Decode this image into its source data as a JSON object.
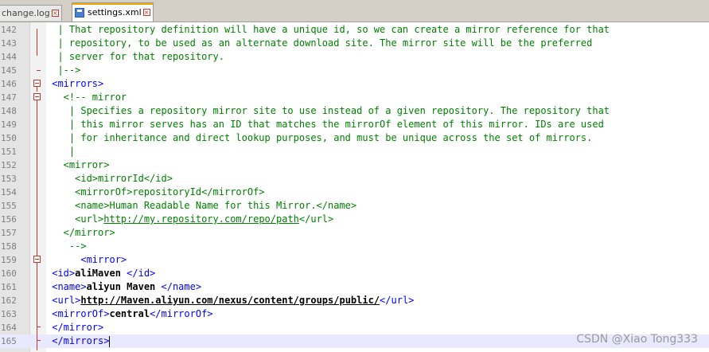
{
  "tabs": [
    {
      "label": "change.log",
      "active": false
    },
    {
      "label": "settings.xml",
      "active": true
    }
  ],
  "lines": [
    {
      "num": "142",
      "parts": [
        {
          "t": "  | That repository definition will have a unique id, so we can create a mirror reference for that",
          "c": "t-comment"
        }
      ]
    },
    {
      "num": "143",
      "parts": [
        {
          "t": "  | repository, to be used as an alternate download site. The mirror site will be the preferred",
          "c": "t-comment"
        }
      ]
    },
    {
      "num": "144",
      "parts": [
        {
          "t": "  | server for that repository.",
          "c": "t-comment"
        }
      ]
    },
    {
      "num": "145",
      "parts": [
        {
          "t": "  |-->",
          "c": "t-comment"
        }
      ]
    },
    {
      "num": "146",
      "parts": [
        {
          "t": " <mirrors>",
          "c": "t-tag"
        }
      ]
    },
    {
      "num": "147",
      "parts": [
        {
          "t": "   <!-- mirror",
          "c": "t-comment"
        }
      ]
    },
    {
      "num": "148",
      "parts": [
        {
          "t": "    | Specifies a repository mirror site to use instead of a given repository. The repository that",
          "c": "t-comment"
        }
      ]
    },
    {
      "num": "149",
      "parts": [
        {
          "t": "    | this mirror serves has an ID that matches the mirrorOf element of this mirror. IDs are used",
          "c": "t-comment"
        }
      ]
    },
    {
      "num": "150",
      "parts": [
        {
          "t": "    | for inheritance and direct lookup purposes, and must be unique across the set of mirrors.",
          "c": "t-comment"
        }
      ]
    },
    {
      "num": "151",
      "parts": [
        {
          "t": "    |",
          "c": "t-comment"
        }
      ]
    },
    {
      "num": "152",
      "parts": [
        {
          "t": "   <mirror>",
          "c": "t-comment"
        }
      ]
    },
    {
      "num": "153",
      "parts": [
        {
          "t": "     <id>mirrorId</id>",
          "c": "t-comment"
        }
      ]
    },
    {
      "num": "154",
      "parts": [
        {
          "t": "     <mirrorOf>repositoryId</mirrorOf>",
          "c": "t-comment"
        }
      ]
    },
    {
      "num": "155",
      "parts": [
        {
          "t": "     <name>Human Readable Name for this Mirror.</name>",
          "c": "t-comment"
        }
      ]
    },
    {
      "num": "156",
      "parts": [
        {
          "t": "     <url>",
          "c": "t-comment"
        },
        {
          "t": "http://my.repository.com/repo/path",
          "c": "t-comment u"
        },
        {
          "t": "</url>",
          "c": "t-comment"
        }
      ]
    },
    {
      "num": "157",
      "parts": [
        {
          "t": "   </mirror>",
          "c": "t-comment"
        }
      ]
    },
    {
      "num": "158",
      "parts": [
        {
          "t": "    -->",
          "c": "t-comment"
        }
      ]
    },
    {
      "num": "159",
      "parts": [
        {
          "t": "      <mirror>",
          "c": "t-tag"
        }
      ]
    },
    {
      "num": "160",
      "parts": [
        {
          "t": " <id>",
          "c": "t-tag"
        },
        {
          "t": "aliMaven ",
          "c": "t-bold"
        },
        {
          "t": "</id>",
          "c": "t-tag"
        }
      ]
    },
    {
      "num": "161",
      "parts": [
        {
          "t": " <name>",
          "c": "t-tag"
        },
        {
          "t": "aliyun Maven ",
          "c": "t-bold"
        },
        {
          "t": "</name>",
          "c": "t-tag"
        }
      ]
    },
    {
      "num": "162",
      "parts": [
        {
          "t": " <url>",
          "c": "t-tag"
        },
        {
          "t": "http://Maven.aliyun.com/nexus/content/groups/public/",
          "c": "t-bold u"
        },
        {
          "t": "</url>",
          "c": "t-tag"
        }
      ]
    },
    {
      "num": "163",
      "parts": [
        {
          "t": " <mirrorOf>",
          "c": "t-tag"
        },
        {
          "t": "central",
          "c": "t-bold"
        },
        {
          "t": "</mirrorOf>",
          "c": "t-tag"
        }
      ]
    },
    {
      "num": "164",
      "parts": [
        {
          "t": " </mirror>",
          "c": "t-tag"
        }
      ]
    },
    {
      "num": "165",
      "parts": [
        {
          "t": " </mirrors>",
          "c": "t-tag"
        }
      ],
      "current": true
    }
  ],
  "watermark": "CSDN @Xiao Tong333",
  "colors": {
    "tag": "#0000ff",
    "comment": "#008000",
    "fold": "#c0392b",
    "current_line": "#e8e8ff"
  }
}
